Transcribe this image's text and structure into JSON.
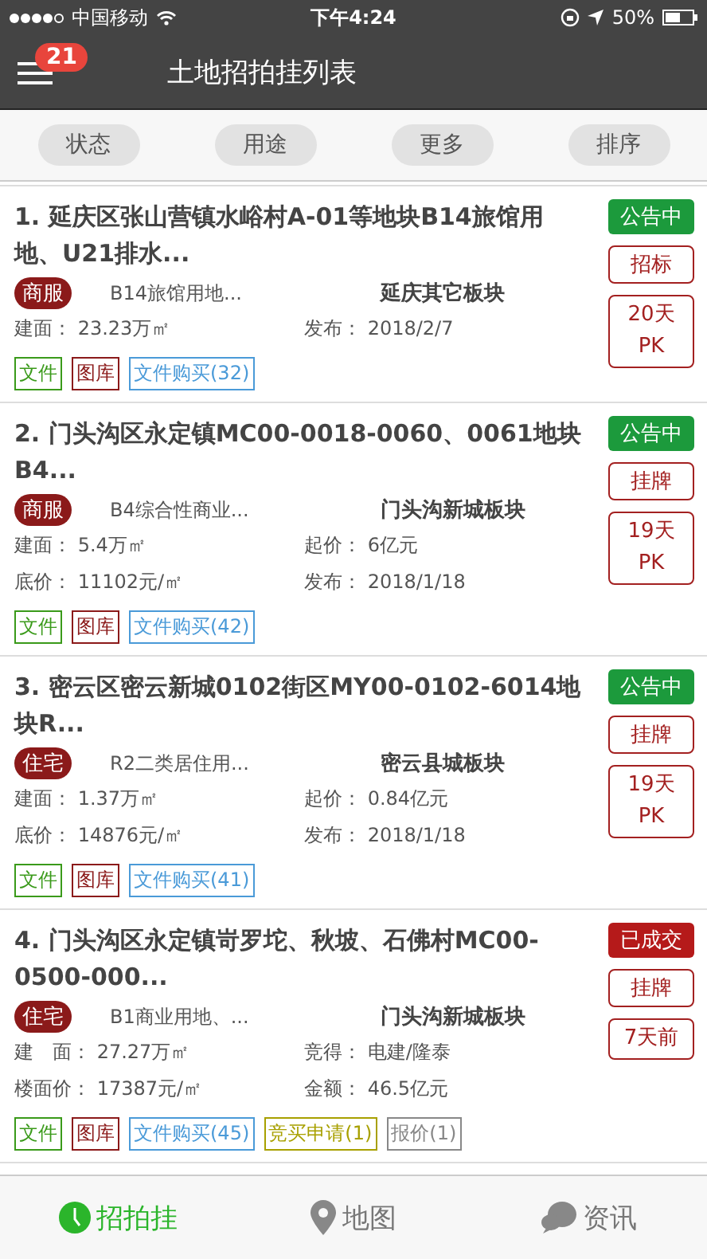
{
  "status_bar": {
    "carrier": "中国移动",
    "time": "下午4:24",
    "battery": "50%"
  },
  "header": {
    "title": "土地招拍挂列表",
    "badge": "21"
  },
  "filters": [
    {
      "label": "状态"
    },
    {
      "label": "用途"
    },
    {
      "label": "更多"
    },
    {
      "label": "排序"
    }
  ],
  "listings": [
    {
      "title": "1. 延庆区张山营镇水峪村A-01等地块B14旅馆用地、U21排水...",
      "category": "商服",
      "usage": "B14旅馆用地...",
      "block": "延庆其它板块",
      "fields": [
        {
          "label": "建面：",
          "value": "23.23万㎡"
        },
        {
          "label": "发布：",
          "value": "2018/2/7"
        }
      ],
      "status": {
        "text": "公告中",
        "kind": "ongoing"
      },
      "method": "招标",
      "countdown": [
        "20天",
        "PK"
      ],
      "tags": [
        {
          "text": "文件",
          "color": "#3a9a1a"
        },
        {
          "text": "图库",
          "color": "#8b1a1a"
        },
        {
          "text": "文件购买(32)",
          "color": "#4a9ad8"
        }
      ]
    },
    {
      "title": "2. 门头沟区永定镇MC00-0018-0060、0061地块B4...",
      "category": "商服",
      "usage": "B4综合性商业...",
      "block": "门头沟新城板块",
      "fields": [
        {
          "label": "建面：",
          "value": "5.4万㎡"
        },
        {
          "label": "起价：",
          "value": "6亿元"
        },
        {
          "label": "底价：",
          "value": "11102元/㎡"
        },
        {
          "label": "发布：",
          "value": "2018/1/18"
        }
      ],
      "status": {
        "text": "公告中",
        "kind": "ongoing"
      },
      "method": "挂牌",
      "countdown": [
        "19天",
        "PK"
      ],
      "tags": [
        {
          "text": "文件",
          "color": "#3a9a1a"
        },
        {
          "text": "图库",
          "color": "#8b1a1a"
        },
        {
          "text": "文件购买(42)",
          "color": "#4a9ad8"
        }
      ]
    },
    {
      "title": "3. 密云区密云新城0102街区MY00-0102-6014地块R...",
      "category": "住宅",
      "usage": "R2二类居住用...",
      "block": "密云县城板块",
      "fields": [
        {
          "label": "建面：",
          "value": "1.37万㎡"
        },
        {
          "label": "起价：",
          "value": "0.84亿元"
        },
        {
          "label": "底价：",
          "value": "14876元/㎡"
        },
        {
          "label": "发布：",
          "value": "2018/1/18"
        }
      ],
      "status": {
        "text": "公告中",
        "kind": "ongoing"
      },
      "method": "挂牌",
      "countdown": [
        "19天",
        "PK"
      ],
      "tags": [
        {
          "text": "文件",
          "color": "#3a9a1a"
        },
        {
          "text": "图库",
          "color": "#8b1a1a"
        },
        {
          "text": "文件购买(41)",
          "color": "#4a9ad8"
        }
      ]
    },
    {
      "title": "4. 门头沟区永定镇岢罗坨、秋坡、石佛村MC00-0500-000...",
      "category": "住宅",
      "usage": "B1商业用地、...",
      "block": "门头沟新城板块",
      "fields": [
        {
          "label": "建　面：",
          "value": "27.27万㎡"
        },
        {
          "label": "竞得：",
          "value": "电建/隆泰"
        },
        {
          "label": "楼面价：",
          "value": "17387元/㎡"
        },
        {
          "label": "金额：",
          "value": "46.5亿元"
        }
      ],
      "status": {
        "text": "已成交",
        "kind": "closed"
      },
      "method": "挂牌",
      "countdown": [
        "7天前"
      ],
      "tags": [
        {
          "text": "文件",
          "color": "#3a9a1a"
        },
        {
          "text": "图库",
          "color": "#8b1a1a"
        },
        {
          "text": "文件购买(45)",
          "color": "#4a9ad8"
        },
        {
          "text": "竞买申请(1)",
          "color": "#a8a000"
        },
        {
          "text": "报价(1)",
          "color": "#888888"
        }
      ]
    }
  ],
  "tabs": [
    {
      "label": "招拍挂",
      "kind": "clock",
      "selected": true
    },
    {
      "label": "地图",
      "kind": "pin",
      "selected": false
    },
    {
      "label": "资讯",
      "kind": "chat",
      "selected": false
    }
  ]
}
